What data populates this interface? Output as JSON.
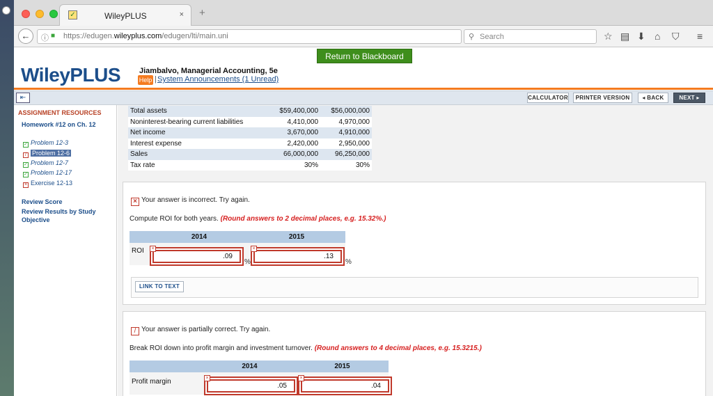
{
  "browser": {
    "tab_title": "WileyPLUS",
    "tab_close": "×",
    "new_tab": "+",
    "url_prefix": "https://edugen.",
    "url_domain": "wileyplus.com",
    "url_path": "/edugen/lti/main.uni",
    "search_placeholder": "Search"
  },
  "header": {
    "return_button": "Return to Blackboard",
    "logo": "WileyPLUS",
    "course_title": "Jiambalvo, Managerial Accounting, 5e",
    "help_label": "Help",
    "separator": "|",
    "announcements": "System Announcements (1 Unread)"
  },
  "toolbar": {
    "calculator": "CALCULATOR",
    "printer": "PRINTER VERSION",
    "back": "◂ BACK",
    "next": "NEXT ▸"
  },
  "sidebar": {
    "section_title": "ASSIGNMENT RESOURCES",
    "homework": "Homework #12 on Ch. 12",
    "items": [
      {
        "label": "Problem 12-3"
      },
      {
        "label": "Problem 12-6"
      },
      {
        "label": "Problem 12-7"
      },
      {
        "label": "Problem 12-17"
      },
      {
        "label": "Exercise 12-13"
      }
    ],
    "review_score": "Review Score",
    "review_results": "Review Results by Study Objective"
  },
  "data_table": {
    "rows": [
      {
        "label": "Total assets",
        "y2014": "$59,400,000",
        "y2015": "$56,000,000"
      },
      {
        "label": "Noninterest-bearing current liabilities",
        "y2014": "4,410,000",
        "y2015": "4,970,000"
      },
      {
        "label": "Net income",
        "y2014": "3,670,000",
        "y2015": "4,910,000"
      },
      {
        "label": "Interest expense",
        "y2014": "2,420,000",
        "y2015": "2,950,000"
      },
      {
        "label": "Sales",
        "y2014": "66,000,000",
        "y2015": "96,250,000"
      },
      {
        "label": "Tax rate",
        "y2014": "30%",
        "y2015": "30%"
      }
    ]
  },
  "part1": {
    "status": "Your answer is incorrect.  Try again.",
    "question": "Compute ROI for both years. ",
    "hint": "(Round answers to 2 decimal places, e.g. 15.32%.)",
    "col_2014": "2014",
    "col_2015": "2015",
    "row_label": "ROI",
    "value_2014": ".09",
    "value_2015": ".13",
    "unit": "%",
    "link_to_text": "LINK TO TEXT"
  },
  "part2": {
    "status_prefix": "Your answer is partially correct.  ",
    "status_suffix": "Try again.",
    "question": "Break ROI down into profit margin and investment turnover. ",
    "hint": "(Round answers to 4 decimal places, e.g. 15.3215.)",
    "col_2014": "2014",
    "col_2015": "2015",
    "row_label": "Profit margin",
    "value_2014": ".05",
    "value_2015": ".04"
  }
}
